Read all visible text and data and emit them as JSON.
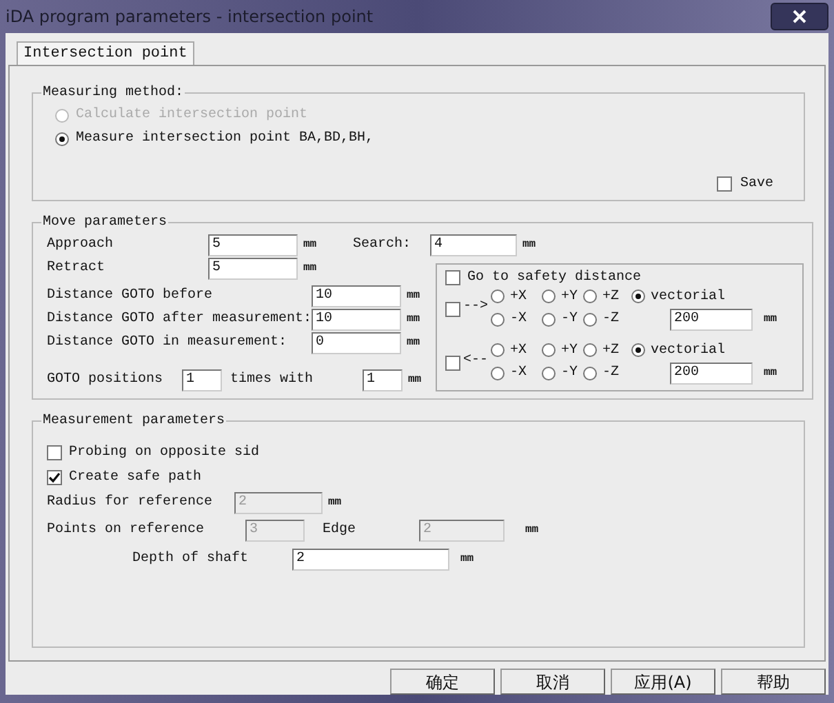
{
  "window": {
    "title": "iDA program parameters - intersection point"
  },
  "tabs": [
    {
      "label": "Intersection point",
      "selected": true
    }
  ],
  "measuring_method": {
    "title": "Measuring method:",
    "options": [
      {
        "label": "Calculate intersection point",
        "selected": false,
        "disabled": true
      },
      {
        "label": "Measure intersection point BA,BD,BH,",
        "selected": true,
        "disabled": false
      }
    ],
    "save": {
      "label": "Save",
      "checked": false
    }
  },
  "move_parameters": {
    "title": "Move parameters",
    "approach": {
      "label": "Approach",
      "value": "5",
      "unit": "mm"
    },
    "search": {
      "label": "Search:",
      "value": "4",
      "unit": "mm"
    },
    "retract": {
      "label": "Retract",
      "value": "5",
      "unit": "mm"
    },
    "distances": [
      {
        "label": "Distance GOTO before",
        "value": "10",
        "unit": "mm"
      },
      {
        "label": "Distance GOTO after measurement:",
        "value": "10",
        "unit": "mm"
      },
      {
        "label": "Distance GOTO in measurement:",
        "value": "0",
        "unit": "mm"
      }
    ],
    "goto_positions": {
      "label": "GOTO positions",
      "value": "1",
      "times_label": "times with",
      "distance": "1",
      "unit": "mm"
    },
    "safety": {
      "label": "Go to safety distance",
      "checked": false,
      "directions": [
        {
          "arrow": "-->",
          "checked": false,
          "top_options": [
            {
              "label": "+X",
              "selected": false
            },
            {
              "label": "+Y",
              "selected": false
            },
            {
              "label": "+Z",
              "selected": false
            },
            {
              "label": "vectorial",
              "selected": true
            }
          ],
          "bottom_options": [
            {
              "label": "-X",
              "selected": false
            },
            {
              "label": "-Y",
              "selected": false
            },
            {
              "label": "-Z",
              "selected": false
            }
          ],
          "value": "200",
          "unit": "mm"
        },
        {
          "arrow": "<--",
          "checked": false,
          "top_options": [
            {
              "label": "+X",
              "selected": false
            },
            {
              "label": "+Y",
              "selected": false
            },
            {
              "label": "+Z",
              "selected": false
            },
            {
              "label": "vectorial",
              "selected": true
            }
          ],
          "bottom_options": [
            {
              "label": "-X",
              "selected": false
            },
            {
              "label": "-Y",
              "selected": false
            },
            {
              "label": "-Z",
              "selected": false
            }
          ],
          "value": "200",
          "unit": "mm"
        }
      ]
    }
  },
  "measurement_parameters": {
    "title": "Measurement parameters",
    "checks": [
      {
        "label": "Probing on opposite sid",
        "checked": false
      },
      {
        "label": "Create safe path",
        "checked": true
      }
    ],
    "radius": {
      "label": "Radius for reference",
      "value": "2",
      "unit": "mm",
      "disabled": true
    },
    "points": {
      "label": "Points on reference",
      "value": "3",
      "disabled": true,
      "edge_label": "Edge",
      "edge_value": "2",
      "unit": "mm"
    },
    "depth": {
      "label": "Depth of shaft",
      "value": "2",
      "unit": "mm",
      "disabled": false
    }
  },
  "buttons": [
    "确定",
    "取消",
    "应用(A)",
    "帮助"
  ]
}
